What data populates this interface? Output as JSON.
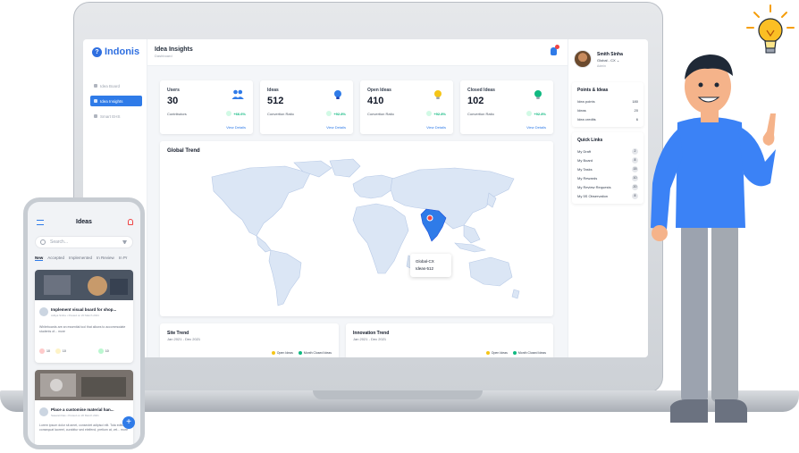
{
  "app": {
    "brand": "Indonis",
    "page_title": "Idea Insights",
    "breadcrumb": "Dashboard",
    "nav": [
      {
        "label": "Idea Board"
      },
      {
        "label": "Idea Insights"
      },
      {
        "label": "Smart EHS"
      }
    ],
    "notification_count": "3"
  },
  "stats": [
    {
      "label": "Users",
      "value": "30",
      "sub": "Contributors",
      "pct": "+66.6%",
      "link": "",
      "icon": "users-icon",
      "color": "#2f7be8"
    },
    {
      "label": "Ideas",
      "value": "512",
      "sub": "Convertion Ratio",
      "pct": "+92.8%",
      "link": "View Details",
      "icon": "bulb-icon",
      "color": "#2f7be8"
    },
    {
      "label": "Open Ideas",
      "value": "410",
      "sub": "Convertion Ratio",
      "pct": "+92.8%",
      "link": "View Details",
      "icon": "bulb-icon",
      "color": "#f5c518"
    },
    {
      "label": "Closed Ideas",
      "value": "102",
      "sub": "Convertion Ratio",
      "pct": "+92.8%",
      "link": "View Details",
      "icon": "bulb-icon",
      "color": "#10b981"
    }
  ],
  "users_link": "View Details",
  "global_trend": {
    "title": "Global Trend",
    "tooltip_title": "Global-CX",
    "tooltip_value": "Ideas-512",
    "highlight_color": "#2f7be8",
    "land_color": "#dbe6f5"
  },
  "site_trend": {
    "title": "Site Trend",
    "range": "Jan 2021 - Dec 2021",
    "legend": [
      "Open Ideas",
      "Month Closed Ideas"
    ]
  },
  "innovation_trend": {
    "title": "Innovation Trend",
    "range": "Jan 2021 - Dec 2021",
    "legend": [
      "Open Ideas",
      "Month Closed Ideas"
    ]
  },
  "legend_colors": {
    "open": "#f5c518",
    "closed": "#10b981"
  },
  "profile": {
    "name": "Smith Sinha",
    "role": "Global - CX",
    "tag": "Admin"
  },
  "points": {
    "title": "Points & Ideas",
    "rows": [
      {
        "label": "Idea points",
        "value": "180"
      },
      {
        "label": "Ideas",
        "value": "20"
      },
      {
        "label": "Idea credits",
        "value": "6"
      }
    ]
  },
  "quick_links": {
    "title": "Quick Links",
    "rows": [
      {
        "label": "My Draft",
        "value": "2"
      },
      {
        "label": "My Board",
        "value": "8"
      },
      {
        "label": "My Tasks",
        "value": "15"
      },
      {
        "label": "My Rewards",
        "value": "10"
      },
      {
        "label": "My Review Requests",
        "value": "20"
      },
      {
        "label": "My 5S Observation",
        "value": "8"
      }
    ]
  },
  "phone": {
    "title": "Ideas",
    "search_placeholder": "Search...",
    "tabs": [
      "New",
      "Accepted",
      "Implemented",
      "In Review",
      "In Pr"
    ],
    "cards": [
      {
        "title": "Implement visual board for shop...",
        "author": "Aditya Sinha",
        "date": "Posted on 20 March 2021",
        "text": "Whiteboards are an essential tool that allows to accommodate students of... more",
        "likes": "10",
        "comments": "10",
        "shares": "10"
      },
      {
        "title": "Place a customise material han...",
        "author": "Saswati Das",
        "date": "Posted on 20 March 2021",
        "text": "Lorem ipsum dolor sit amet, consectet adipisci elit. Tota editud a consequat laoreet, curabitur sed eleifend, pretium at, vel... more"
      }
    ]
  }
}
